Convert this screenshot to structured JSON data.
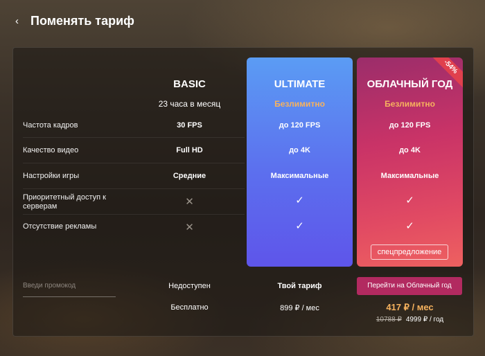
{
  "header": {
    "back_icon": "chevron-left-icon",
    "title": "Поменять тариф"
  },
  "plans": {
    "basic": {
      "name": "BASIC",
      "hours": "23 часа в месяц"
    },
    "ultimate": {
      "name": "ULTIMATE",
      "hours": "Безлимитно"
    },
    "cloud": {
      "name": "ОБЛАЧНЫЙ ГОД",
      "hours": "Безлимитно",
      "badge": "-54%"
    }
  },
  "rows": [
    {
      "label": "Частота кадров",
      "basic": "30 FPS",
      "ultimate": "до 120 FPS",
      "cloud": "до 120 FPS"
    },
    {
      "label": "Качество видео",
      "basic": "Full HD",
      "ultimate": "до 4K",
      "cloud": "до 4K"
    },
    {
      "label": "Настройки игры",
      "basic": "Средние",
      "ultimate": "Максимальные",
      "cloud": "Максимальные"
    },
    {
      "label": "Приоритетный доступ к серверам",
      "basic": "cross-icon",
      "ultimate": "check-icon",
      "cloud": "check-icon"
    },
    {
      "label": "Отсутствие рекламы",
      "basic": "cross-icon",
      "ultimate": "check-icon",
      "cloud": "check-icon"
    }
  ],
  "special_offer": "спецпредложение",
  "promo": {
    "placeholder": "Введи промокод"
  },
  "bottom": {
    "basic_status": "Недоступен",
    "ultimate_status": "Твой тариф",
    "cloud_button": "Перейти на Облачный год",
    "basic_price": "Бесплатно",
    "ultimate_price": "899 ₽ / мес",
    "cloud_price": "417 ₽ / мес",
    "cloud_old_price": "10788 ₽",
    "cloud_year_price": "4999 ₽ / год"
  },
  "colors": {
    "accent_orange": "#f6b25e",
    "ultimate": "#5c6fee",
    "cloud": "#c93367",
    "badge": "#e0404d"
  }
}
